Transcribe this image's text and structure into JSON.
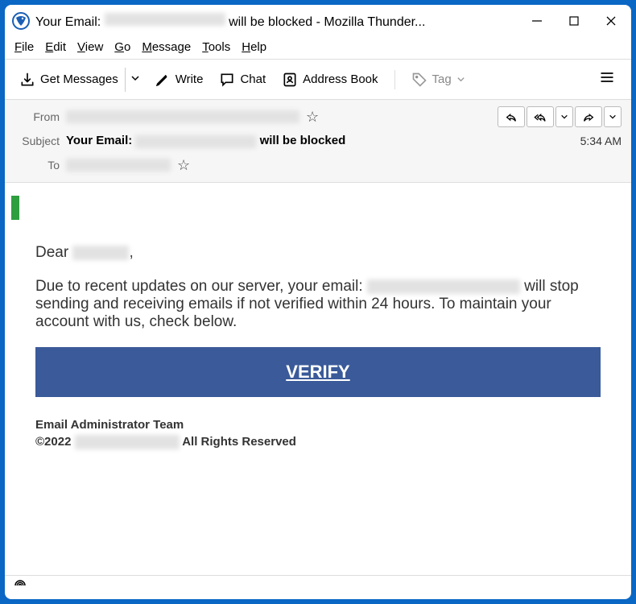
{
  "titlebar": {
    "title_prefix": "Your Email: ",
    "title_suffix": " will be blocked - Mozilla Thunder..."
  },
  "menubar": [
    {
      "ul": "F",
      "rest": "ile"
    },
    {
      "ul": "E",
      "rest": "dit"
    },
    {
      "ul": "V",
      "rest": "iew"
    },
    {
      "ul": "G",
      "rest": "o"
    },
    {
      "ul": "M",
      "rest": "essage"
    },
    {
      "ul": "T",
      "rest": "ools"
    },
    {
      "ul": "H",
      "rest": "elp"
    }
  ],
  "toolbar": {
    "get_messages": "Get Messages",
    "write": "Write",
    "chat": "Chat",
    "address_book": "Address Book",
    "tag": "Tag"
  },
  "headers": {
    "from_label": "From",
    "subject_label": "Subject",
    "to_label": "To",
    "subject_prefix": "Your Email: ",
    "subject_suffix": " will be blocked",
    "time": "5:34 AM"
  },
  "body": {
    "greeting_prefix": "Dear ",
    "greeting_suffix": ",",
    "p1_a": "Due to recent updates on our server, your email: ",
    "p1_b": " will stop sending and receiving emails if not verified within 24 hours. To maintain your account with us, check below.",
    "verify_label": "VERIFY",
    "sig_line1": "Email Administrator Team",
    "sig_line2_a": "©2022",
    "sig_line2_b": "All Rights Reserved"
  }
}
